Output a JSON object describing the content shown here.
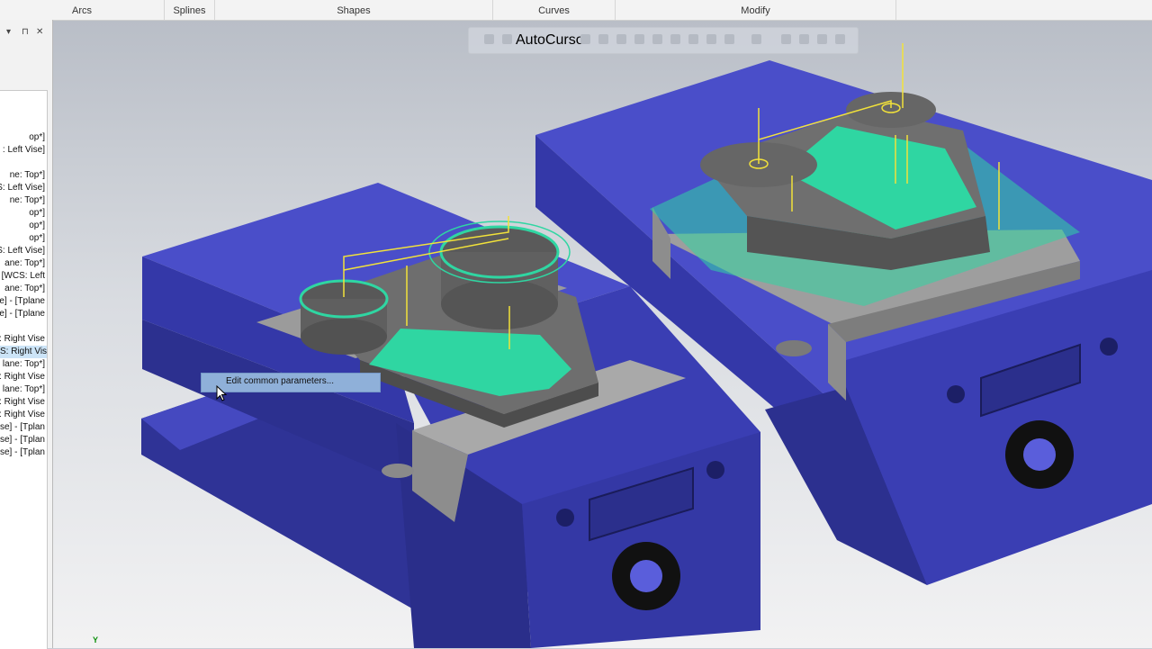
{
  "ribbon": {
    "groups": [
      "Arcs",
      "Splines",
      "Shapes",
      "Curves",
      "Modify"
    ]
  },
  "panel": {
    "controls": [
      "▾",
      "⊓",
      "✕"
    ],
    "tree_rows": [
      "op*]",
      ": Left Vise]",
      "ne: Top*]",
      "S: Left Vise]",
      "ne: Top*]",
      "op*]",
      "op*]",
      "op*]",
      "S: Left Vise]",
      "ane: Top*]",
      "- [WCS: Left",
      "ane: Top*]",
      "e] - [Tplane",
      "e] - [Tplane",
      "S: Right Vise",
      "S: Right Vise",
      "lane: Top*]",
      "S: Right Vise",
      "lane: Top*]",
      "S: Right Vise",
      "S: Right Vise",
      "ise] - [Tplan",
      "ise] - [Tplan",
      "ise] - [Tplan"
    ]
  },
  "quick_toolbar": {
    "label": "AutoCursor"
  },
  "context_menu": {
    "item": "Edit common parameters..."
  },
  "axis": {
    "y": "Y"
  },
  "colors": {
    "vise_blue": "#3b3fb0",
    "stock_gray": "#8a8a8a",
    "toolpath_green": "#2fd6a2",
    "toolpath_yellow": "#f2e23a"
  }
}
